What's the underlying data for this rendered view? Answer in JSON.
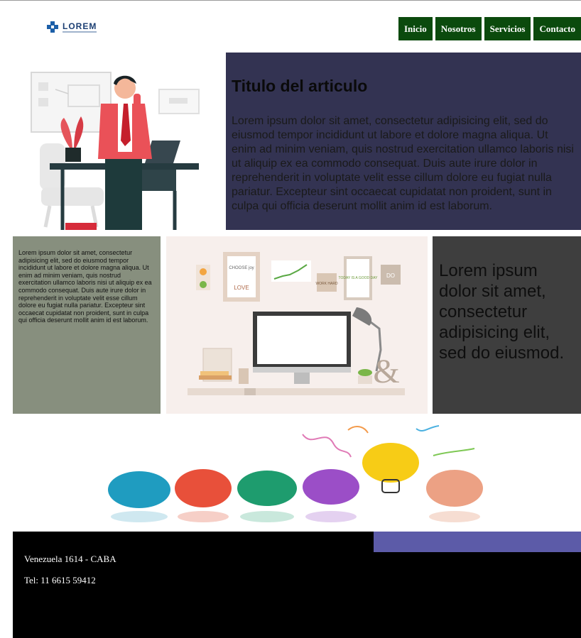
{
  "header": {
    "logo_text": "LOREM",
    "nav": [
      "Inicio",
      "Nosotros",
      "Servicios",
      "Contacto"
    ]
  },
  "hero": {
    "title": "Titulo del articulo",
    "body": "Lorem ipsum dolor sit amet, consectetur adipisicing elit, sed do eiusmod tempor incididunt ut labore et dolore magna aliqua. Ut enim ad minim veniam, quis nostrud exercitation ullamco laboris nisi ut aliquip ex ea commodo consequat. Duis aute irure dolor in reprehenderit in voluptate velit esse cillum dolore eu fugiat nulla pariatur. Excepteur sint occaecat cupidatat non proident, sunt in culpa qui officia deserunt mollit anim id est laborum."
  },
  "row2": {
    "small_text": "Lorem ipsum dolor sit amet, consectetur adipisicing elit, sed do eiusmod tempor incididunt ut labore et dolore magna aliqua. Ut enim ad minim veniam, quis nostrud exercitation ullamco laboris nisi ut aliquip ex ea commodo consequat. Duis aute irure dolor in reprehenderit in voluptate velit esse cillum dolore eu fugiat nulla pariatur. Excepteur sint occaecat cupidatat non proident, sunt in culpa qui officia deserunt mollit anim id est laborum.",
    "big_text": "Lorem ipsum dolor sit amet, consectetur adipisicing elit, sed do eiusmod.",
    "poster_texts": [
      "CHOOSE joy",
      "LOVE",
      "TODAY IS A GOOD DAY",
      "WORK HARD",
      "DO"
    ]
  },
  "footer": {
    "address": "Venezuela 1614 - CABA",
    "phone": "Tel: 11 6615 59412"
  },
  "colors": {
    "nav_bg": "#0b4a0d",
    "article_bg": "#333352",
    "green_box": "#878f7e",
    "dark_box": "#3e3e3e",
    "footer_bg": "#000000",
    "footer_accent": "#5c5ba8"
  }
}
